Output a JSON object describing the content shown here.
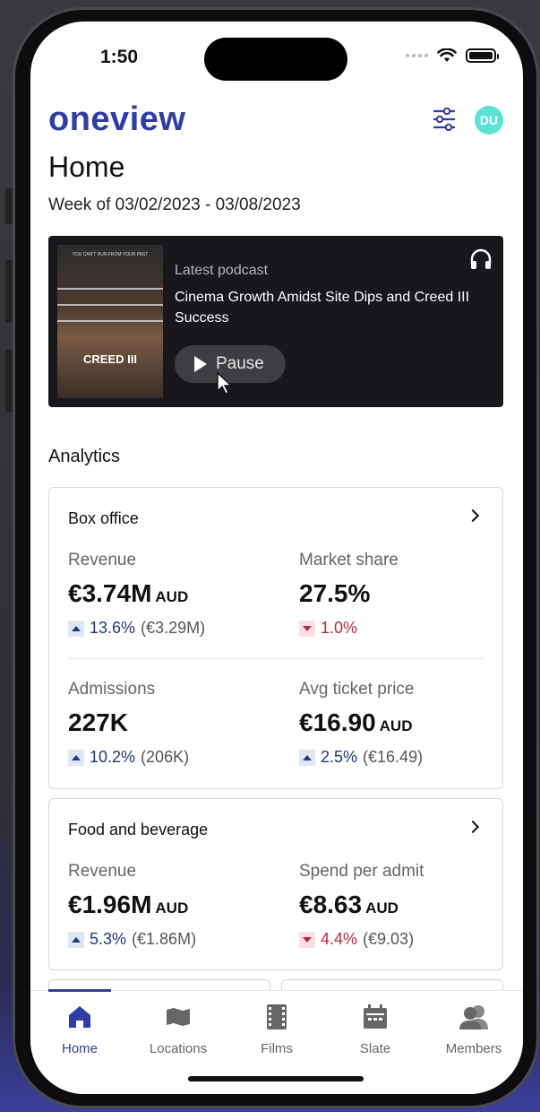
{
  "status": {
    "time": "1:50"
  },
  "header": {
    "logo": "oneview",
    "avatar_initials": "DU"
  },
  "page": {
    "title": "Home",
    "week": "Week of 03/02/2023 - 03/08/2023"
  },
  "podcast": {
    "label": "Latest podcast",
    "title": "Cinema Growth Amidst Site Dips and Creed III Success",
    "button_label": "Pause",
    "poster_tagline": "YOU CAN'T RUN FROM YOUR PAST",
    "poster_title": "CREED III"
  },
  "analytics": {
    "title": "Analytics",
    "box_office": {
      "title": "Box office",
      "metrics": [
        {
          "label": "Revenue",
          "value": "€3.74M",
          "unit": "AUD",
          "change": "13.6%",
          "previous": "(€3.29M)",
          "direction": "up"
        },
        {
          "label": "Market share",
          "value": "27.5%",
          "unit": "",
          "change": "1.0%",
          "previous": "",
          "direction": "down"
        },
        {
          "label": "Admissions",
          "value": "227K",
          "unit": "",
          "change": "10.2%",
          "previous": "(206K)",
          "direction": "up"
        },
        {
          "label": "Avg ticket price",
          "value": "€16.90",
          "unit": "AUD",
          "change": "2.5%",
          "previous": "(€16.49)",
          "direction": "up"
        }
      ]
    },
    "food_beverage": {
      "title": "Food and beverage",
      "metrics": [
        {
          "label": "Revenue",
          "value": "€1.96M",
          "unit": "AUD",
          "change": "5.3%",
          "previous": "(€1.86M)",
          "direction": "up"
        },
        {
          "label": "Spend per admit",
          "value": "€8.63",
          "unit": "AUD",
          "change": "4.4%",
          "previous": "(€9.03)",
          "direction": "down"
        }
      ]
    }
  },
  "tabs": [
    {
      "label": "Home",
      "icon": "home-icon",
      "active": true
    },
    {
      "label": "Locations",
      "icon": "map-icon",
      "active": false
    },
    {
      "label": "Films",
      "icon": "film-icon",
      "active": false
    },
    {
      "label": "Slate",
      "icon": "calendar-icon",
      "active": false
    },
    {
      "label": "Members",
      "icon": "members-icon",
      "active": false
    }
  ],
  "colors": {
    "brand": "#2e3ea6",
    "avatar": "#5ae3d5",
    "up": "#1f3a7a",
    "down": "#c0283a"
  }
}
